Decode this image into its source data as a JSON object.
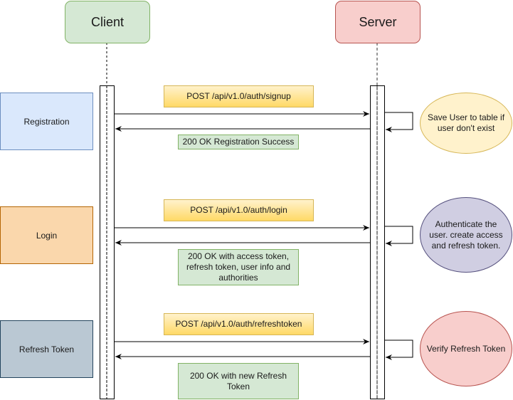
{
  "actors": {
    "client": {
      "label": "Client",
      "fill": "#d5e8d4",
      "stroke": "#82b366"
    },
    "server": {
      "label": "Server",
      "fill": "#f8cecc",
      "stroke": "#b85450"
    }
  },
  "phases": [
    {
      "label": "Registration",
      "fill": "#dae8fc",
      "stroke": "#6c8ebf",
      "request": "POST /api/v1.0/auth/signup",
      "response": "200 OK Registration Success",
      "server_action": "Save User to table if user don't exist",
      "action_fill": "#fff2cc",
      "action_stroke": "#d6b656"
    },
    {
      "label": "Login",
      "fill": "#fad7ac",
      "stroke": "#b46504",
      "request": "POST /api/v1.0/auth/login",
      "response": "200 OK with access token, refresh token, user info and authorities",
      "server_action": "Authenticate the user. create access and refresh token.",
      "action_fill": "#d0cee2",
      "action_stroke": "#56517e"
    },
    {
      "label": "Refresh Token",
      "fill": "#bac8d3",
      "stroke": "#23445d",
      "request": "POST /api/v1.0/auth/refreshtoken",
      "response": "200 OK with new Refresh Token",
      "server_action": "Verify Refresh Token",
      "action_fill": "#f8cecc",
      "action_stroke": "#b85450"
    }
  ],
  "colors": {
    "request_fill": "#ffd966",
    "request_fill_top": "#fff2cc",
    "request_stroke": "#d6b656",
    "response_fill": "#d5e8d4",
    "response_stroke": "#82b366"
  }
}
